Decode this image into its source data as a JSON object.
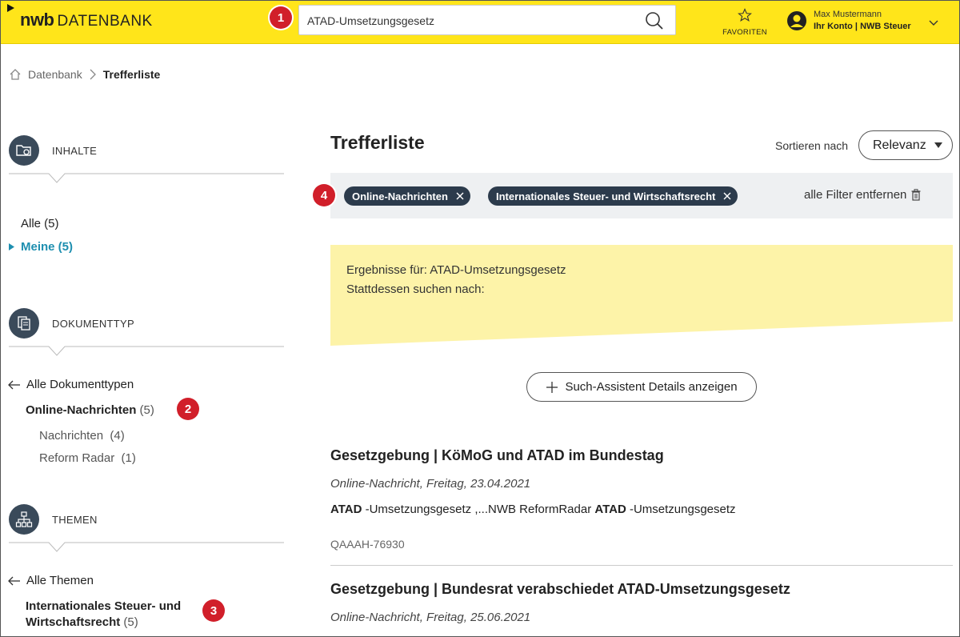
{
  "header": {
    "logo_bold": "nwb",
    "logo_text": "DATENBANK",
    "search_value": "ATAD-Umsetzungsgesetz",
    "favorites_label": "FAVORITEN",
    "user_name": "Max Mustermann",
    "account_label": "Ihr Konto | NWB Steuer"
  },
  "breadcrumb": {
    "home": "Datenbank",
    "current": "Trefferliste"
  },
  "badges": [
    "1",
    "2",
    "3",
    "4"
  ],
  "sidebar": {
    "inhalte": {
      "title": "INHALTE",
      "items": [
        {
          "label": "Alle (5)"
        },
        {
          "label": "Meine (5)"
        }
      ]
    },
    "dokumenttyp": {
      "title": "DOKUMENTTYP",
      "back_label": "Alle Dokumenttypen",
      "selected_label": "Online-Nachrichten",
      "selected_count": "(5)",
      "children": [
        {
          "label": "Nachrichten",
          "count": "(4)"
        },
        {
          "label": "Reform Radar",
          "count": "(1)"
        }
      ]
    },
    "themen": {
      "title": "THEMEN",
      "back_label": "Alle Themen",
      "selected_line1": "Internationales Steuer- und",
      "selected_line2": "Wirtschaftsrecht",
      "selected_count": "(5)"
    }
  },
  "main": {
    "title": "Trefferliste",
    "sort_label": "Sortieren nach",
    "sort_value": "Relevanz",
    "filters": [
      {
        "label": "Online-Nachrichten"
      },
      {
        "label": "Internationales Steuer- und Wirtschaftsrecht"
      }
    ],
    "clear_filters_label": "alle Filter entfernen",
    "results_for": "Ergebnisse für: ATAD-Umsetzungsgesetz",
    "instead_search": "Stattdessen suchen nach:",
    "assistant_label": "Such-Assistent Details anzeigen",
    "results": [
      {
        "title": "Gesetzgebung | KöMoG und ATAD im Bundestag",
        "meta": "Online-Nachricht, Freitag, 23.04.2021",
        "snip_b1": "ATAD",
        "snip_t1": " -Umsetzungsgesetz ,...NWB ReformRadar ",
        "snip_b2": "ATAD",
        "snip_t2": " -Umsetzungsgesetz",
        "id": "QAAAH-76930"
      },
      {
        "title": "Gesetzgebung | Bundesrat verabschiedet ATAD-Umsetzungsgesetz",
        "meta": "Online-Nachricht, Freitag, 25.06.2021"
      }
    ]
  },
  "colors": {
    "header_yellow": "#ffe51a",
    "accent_blue": "#1e8fb0",
    "chip_dark": "#2c3b4c",
    "badge_red": "#d11f2a",
    "note_yellow": "#fdf3a8"
  }
}
